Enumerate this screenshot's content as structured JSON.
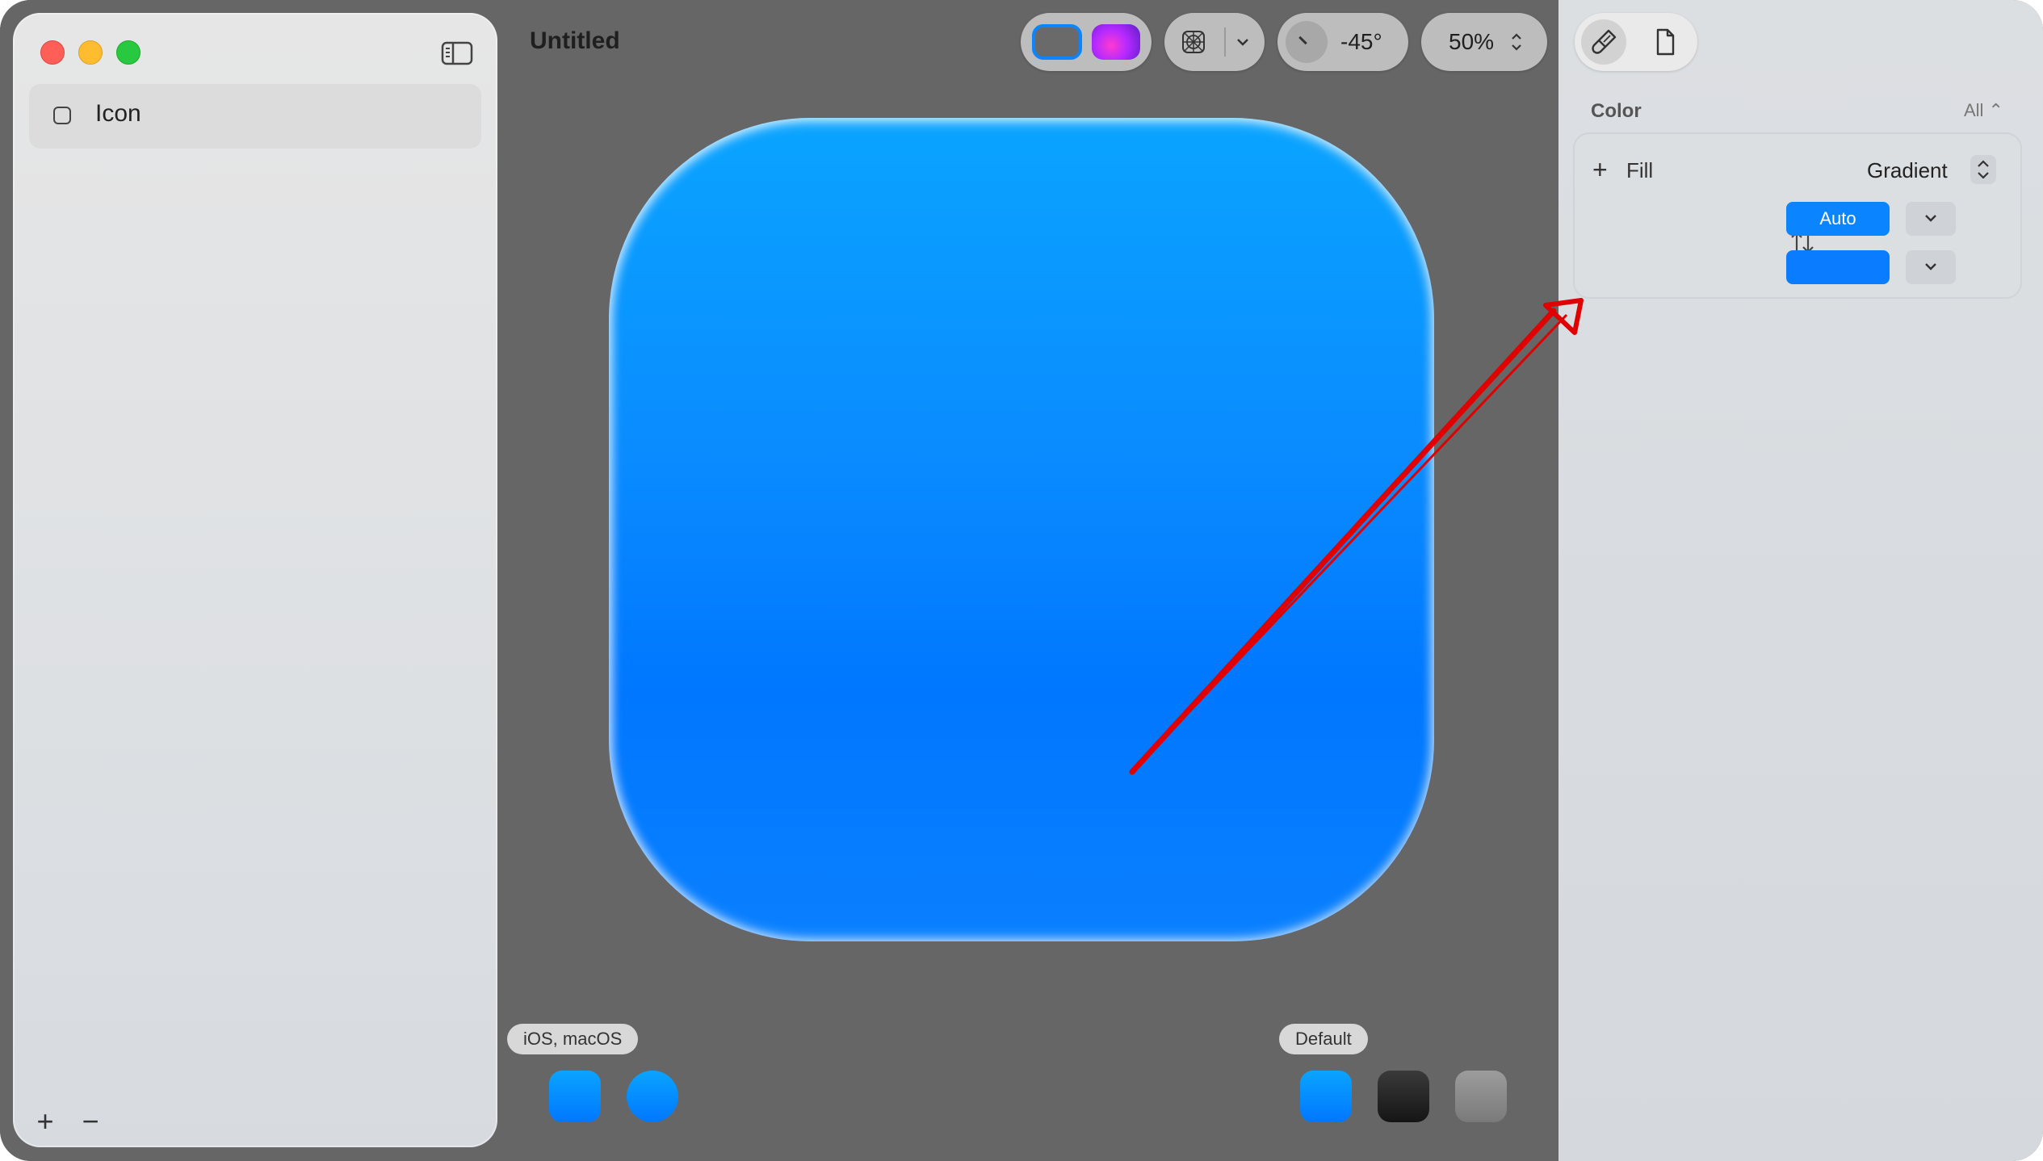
{
  "window": {
    "title": "Untitled"
  },
  "sidebar": {
    "layers": [
      {
        "label": "Icon"
      }
    ],
    "add_label": "+",
    "remove_label": "−"
  },
  "toolbar": {
    "angle_label": "-45°",
    "zoom_label": "50%"
  },
  "canvas": {
    "platform_label": "iOS, macOS",
    "appearance_label": "Default",
    "icon_color_top": "#0aa4ff",
    "icon_color_bottom": "#0077ff"
  },
  "inspector": {
    "section_title": "Color",
    "section_scope": "All ⌃",
    "fill_add": "+",
    "fill_label": "Fill",
    "fill_type": "Gradient",
    "stop_1_label": "Auto",
    "accent_color": "#0a84ff"
  },
  "annotation": {
    "arrow_color": "#e00000"
  }
}
